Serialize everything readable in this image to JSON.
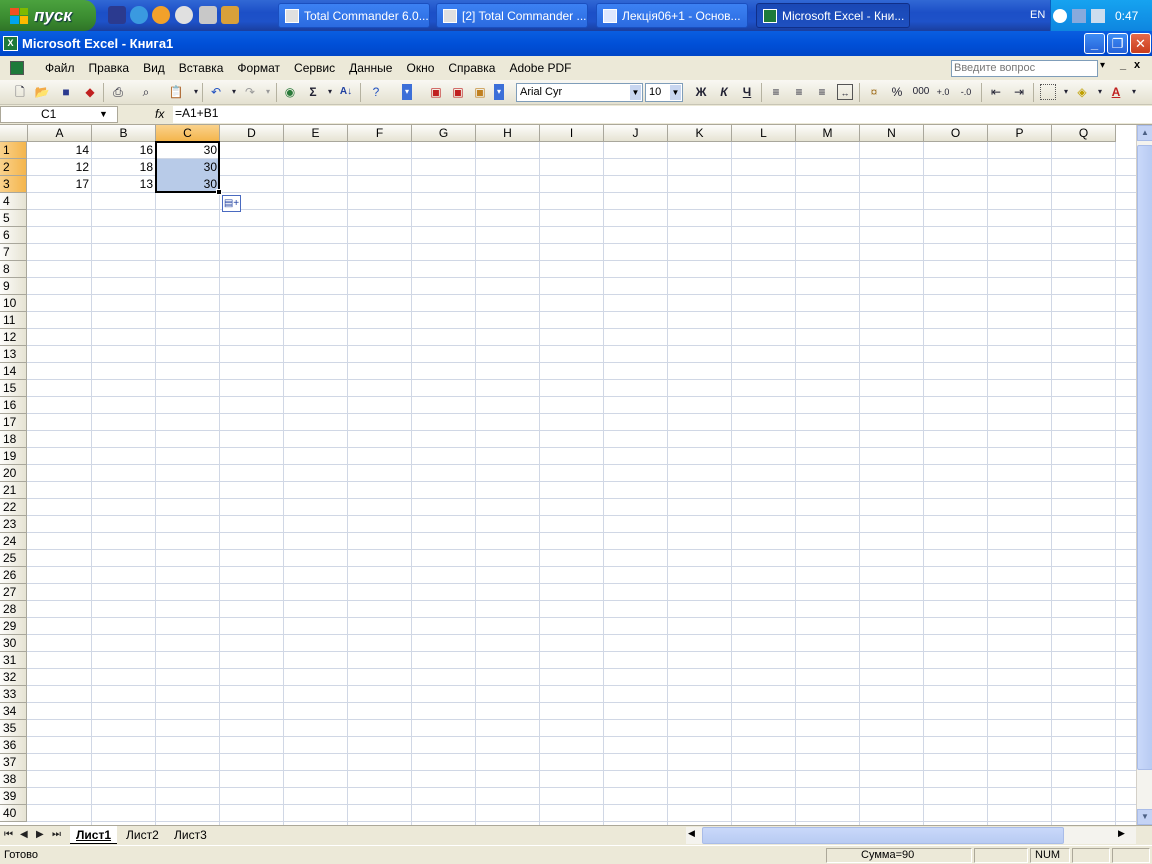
{
  "taskbar": {
    "start_label": "пуск",
    "windows": [
      {
        "label": "Total Commander 6.0..."
      },
      {
        "label": "[2] Total Commander ..."
      },
      {
        "label": "Лекція06+1 - Основ..."
      },
      {
        "label": "Microsoft Excel - Кни..."
      }
    ],
    "lang": "EN",
    "clock": "0:47"
  },
  "window": {
    "title": "Microsoft Excel - Книга1"
  },
  "menu": {
    "items": [
      "Файл",
      "Правка",
      "Вид",
      "Вставка",
      "Формат",
      "Сервис",
      "Данные",
      "Окно",
      "Справка",
      "Adobe PDF"
    ],
    "ask_placeholder": "Введите вопрос"
  },
  "toolbar": {
    "font_name": "Arial Cyr",
    "font_size": "10",
    "bold": "Ж",
    "italic": "К",
    "underline": "Ч",
    "percent": "%",
    "thousands": "000",
    "sigma": "Σ"
  },
  "formula_bar": {
    "name_box": "C1",
    "fx": "fx",
    "formula": "=A1+B1"
  },
  "sheet": {
    "columns": [
      "A",
      "B",
      "C",
      "D",
      "E",
      "F",
      "G",
      "H",
      "I",
      "J",
      "K",
      "L",
      "M",
      "N",
      "O",
      "P",
      "Q"
    ],
    "selected_column": "C",
    "rows": [
      "1",
      "2",
      "3",
      "4",
      "5",
      "6",
      "7",
      "8",
      "9",
      "10",
      "11",
      "12",
      "13",
      "14",
      "15",
      "16",
      "17",
      "18",
      "19",
      "20",
      "21",
      "22",
      "23",
      "24",
      "25",
      "26",
      "27",
      "28",
      "29",
      "30",
      "31",
      "32",
      "33",
      "34",
      "35",
      "36",
      "37",
      "38",
      "39",
      "40"
    ],
    "selected_rows": [
      "1",
      "2",
      "3"
    ],
    "cells": [
      {
        "ref": "A1",
        "value": "14"
      },
      {
        "ref": "B1",
        "value": "16"
      },
      {
        "ref": "C1",
        "value": "30"
      },
      {
        "ref": "A2",
        "value": "12"
      },
      {
        "ref": "B2",
        "value": "18"
      },
      {
        "ref": "C2",
        "value": "30"
      },
      {
        "ref": "A3",
        "value": "17"
      },
      {
        "ref": "B3",
        "value": "13"
      },
      {
        "ref": "C3",
        "value": "30"
      }
    ],
    "selection": "C1:C3"
  },
  "sheet_tabs": {
    "tabs": [
      "Лист1",
      "Лист2",
      "Лист3"
    ],
    "active": "Лист1"
  },
  "status": {
    "ready": "Готово",
    "sum": "Сумма=90",
    "num": "NUM"
  }
}
